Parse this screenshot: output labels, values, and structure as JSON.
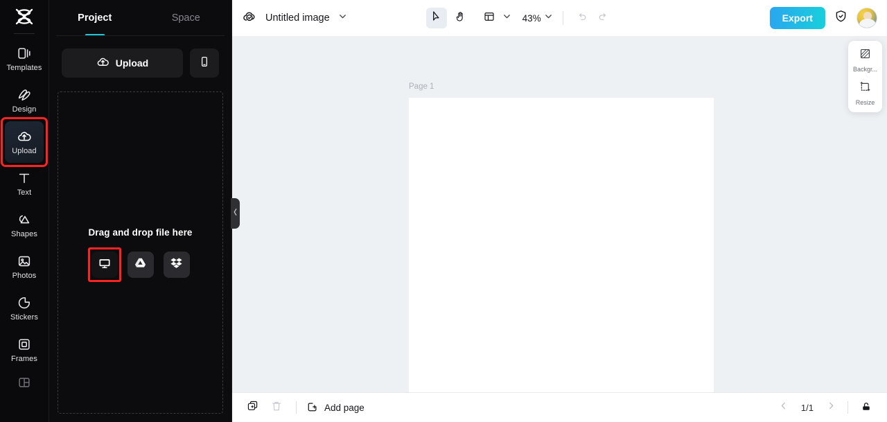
{
  "rail": {
    "logo_icon": "capcut-logo-icon",
    "items": [
      {
        "label": "Templates",
        "icon": "templates-icon",
        "active": false
      },
      {
        "label": "Design",
        "icon": "design-icon",
        "active": false
      },
      {
        "label": "Upload",
        "icon": "upload-cloud-icon",
        "active": true
      },
      {
        "label": "Text",
        "icon": "text-icon",
        "active": false
      },
      {
        "label": "Shapes",
        "icon": "shapes-icon",
        "active": false
      },
      {
        "label": "Photos",
        "icon": "photos-icon",
        "active": false
      },
      {
        "label": "Stickers",
        "icon": "stickers-icon",
        "active": false
      },
      {
        "label": "Frames",
        "icon": "frames-icon",
        "active": false
      },
      {
        "label": "",
        "icon": "grid-layout-icon",
        "active": false
      }
    ],
    "highlight_color": "#ff2222"
  },
  "panel": {
    "tabs": [
      {
        "label": "Project",
        "active": true
      },
      {
        "label": "Space",
        "active": false
      }
    ],
    "accent_color": "#1fc6d6",
    "upload_button": {
      "label": "Upload",
      "icon": "upload-cloud-icon"
    },
    "phone_button": {
      "icon": "mobile-phone-icon"
    },
    "dropzone": {
      "text": "Drag and drop file here",
      "sources": [
        {
          "name": "computer",
          "icon": "monitor-icon",
          "highlighted": true
        },
        {
          "name": "google-drive",
          "icon": "google-drive-icon",
          "highlighted": false
        },
        {
          "name": "dropbox",
          "icon": "dropbox-icon",
          "highlighted": false
        }
      ]
    },
    "collapse_handle_icon": "chevron-left-icon"
  },
  "topbar": {
    "cloud_icon": "cloud-check-icon",
    "document_title": "Untitled image",
    "title_chevron_icon": "chevron-down-icon",
    "tools": [
      {
        "name": "select-tool",
        "icon": "cursor-arrow-icon",
        "active": true
      },
      {
        "name": "hand-tool",
        "icon": "hand-icon",
        "active": false
      },
      {
        "name": "layout-tool",
        "icon": "layout-panels-icon",
        "active": false
      }
    ],
    "layout_chevron_icon": "chevron-down-icon",
    "zoom_level": "43%",
    "zoom_chevron_icon": "chevron-down-icon",
    "undo_icon": "undo-icon",
    "redo_icon": "redo-icon",
    "export_label": "Export",
    "export_color": "#18d0dc",
    "shield_icon": "shield-check-icon",
    "avatar_icon": "user-avatar"
  },
  "canvas": {
    "page_label": "Page 1",
    "page_background": "#ffffff",
    "workspace_background": "#eef1f4"
  },
  "float_panel": {
    "items": [
      {
        "label": "Backgr...",
        "icon": "background-pattern-icon"
      },
      {
        "label": "Resize",
        "icon": "resize-icon"
      }
    ]
  },
  "bottombar": {
    "duplicate_icon": "duplicate-page-icon",
    "delete_icon": "trash-icon",
    "add_page_label": "Add page",
    "add_page_icon": "add-page-icon",
    "prev_icon": "chevron-left-icon",
    "page_indicator": "1/1",
    "next_icon": "chevron-right-icon",
    "lock_icon": "lock-open-icon"
  }
}
